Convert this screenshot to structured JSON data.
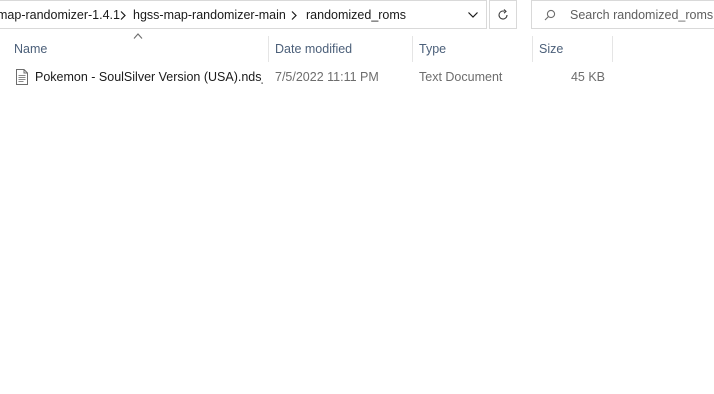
{
  "breadcrumbs": [
    {
      "label": "map-randomizer-1.4.1"
    },
    {
      "label": "hgss-map-randomizer-main"
    },
    {
      "label": "randomized_roms"
    }
  ],
  "search": {
    "placeholder": "Search randomized_roms",
    "value": ""
  },
  "columns": {
    "name": "Name",
    "date_modified": "Date modified",
    "type": "Type",
    "size": "Size"
  },
  "sort": {
    "column": "name",
    "direction": "ascending"
  },
  "files": [
    {
      "icon": "text-document-icon",
      "name": "Pokemon - SoulSilver Version (USA).nds_...",
      "date_modified": "7/5/2022 11:11 PM",
      "type": "Text Document",
      "size": "45 KB"
    }
  ],
  "colors": {
    "header_text": "#4c607a",
    "border": "#d9d9d9",
    "secondary_text": "#6d6d6d"
  }
}
